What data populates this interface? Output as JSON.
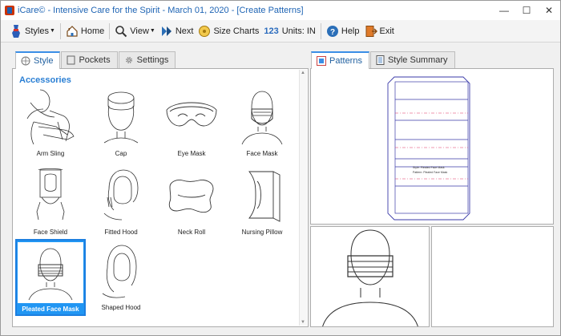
{
  "window": {
    "title": "iCare© - Intensive Care for the Spirit - March 01, 2020 - [Create Patterns]",
    "minimize": "—",
    "maximize": "☐",
    "close": "✕"
  },
  "toolbar": {
    "styles_label": "Styles",
    "home_label": "Home",
    "view_label": "View",
    "next_label": "Next",
    "size_charts_label": "Size Charts",
    "units_icon_text": "123",
    "units_label": "Units:  IN",
    "help_label": "Help",
    "exit_label": "Exit"
  },
  "left_tabs": [
    {
      "label": "Style",
      "active": true
    },
    {
      "label": "Pockets",
      "active": false
    },
    {
      "label": "Settings",
      "active": false
    }
  ],
  "right_tabs": [
    {
      "label": "Patterns",
      "active": true
    },
    {
      "label": "Style Summary",
      "active": false
    }
  ],
  "section_title": "Accessories",
  "gallery": {
    "items": [
      {
        "label": "Arm Sling",
        "icon": "arm-sling"
      },
      {
        "label": "Cap",
        "icon": "cap"
      },
      {
        "label": "Eye Mask",
        "icon": "eye-mask"
      },
      {
        "label": "Face Mask",
        "icon": "face-mask"
      },
      {
        "label": "Face Shield",
        "icon": "face-shield"
      },
      {
        "label": "Fitted Hood",
        "icon": "fitted-hood"
      },
      {
        "label": "Neck Roll",
        "icon": "neck-roll"
      },
      {
        "label": "Nursing Pillow",
        "icon": "nursing-pillow"
      },
      {
        "label": "Pleated Face Mask",
        "icon": "pleated-face-mask",
        "selected": true
      },
      {
        "label": "Shaped Hood",
        "icon": "shaped-hood"
      }
    ]
  },
  "pattern_preview": {
    "text_line1": "Style: Pleated Face Mask",
    "text_line2": "Pattern: Pleated Face Mask",
    "outline_color": "#3a3aa8",
    "pleat_color": "#e03060"
  },
  "colors": {
    "accent": "#2196f3",
    "title_text": "#1e64b4",
    "section_text": "#2a7fd4"
  }
}
